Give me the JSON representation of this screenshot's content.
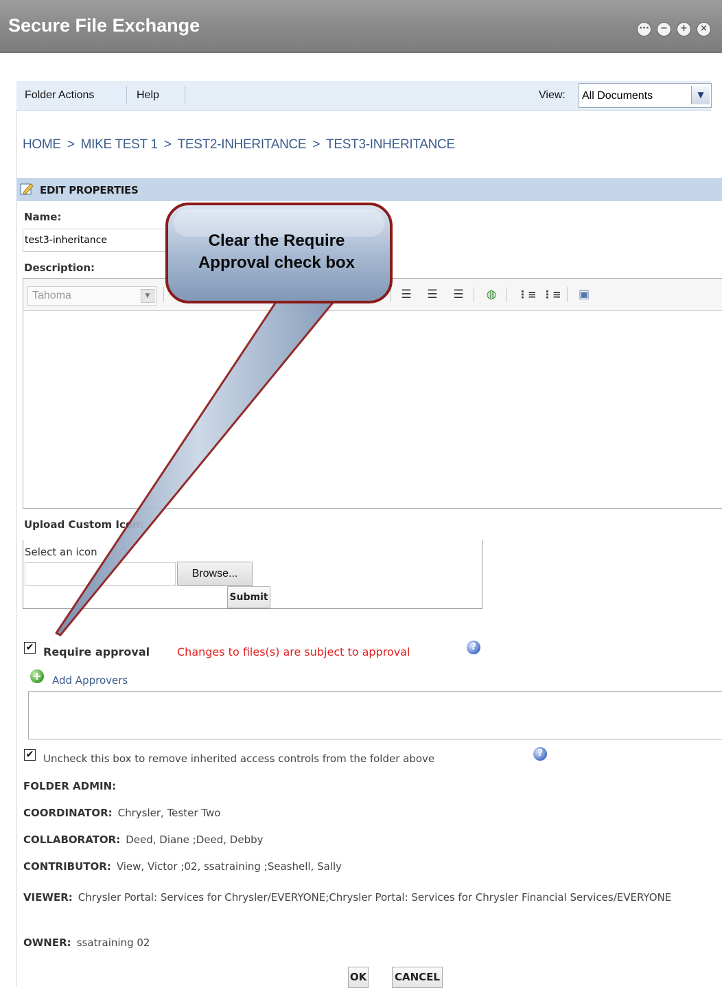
{
  "window": {
    "title": "Secure File Exchange",
    "buttons": [
      "···",
      "−",
      "+",
      "×"
    ]
  },
  "toolbar": {
    "folder_actions": "Folder Actions",
    "help": "Help",
    "view_label": "View:",
    "view_value": "All Documents"
  },
  "breadcrumb": {
    "items": [
      "HOME",
      "MIKE TEST 1",
      "TEST2-INHERITANCE",
      "TEST3-INHERITANCE"
    ],
    "separator": ">"
  },
  "section": {
    "title": "EDIT PROPERTIES"
  },
  "form": {
    "name_label": "Name:",
    "name_value": "test3-inheritance",
    "description_label": "Description:",
    "font_value": "Tahoma",
    "upload_label": "Upload Custom Icon:",
    "select_icon": "Select an icon",
    "browse": "Browse...",
    "submit": "Submit",
    "require_approval_label": "Require approval",
    "require_approval_checked": true,
    "approval_note": "Changes to files(s) are subject to approval",
    "add_approvers": "Add Approvers",
    "inherit_label": "Uncheck this box to remove inherited access controls from the folder above",
    "inherit_checked": true
  },
  "roles": {
    "folder_admin": {
      "label": "FOLDER ADMIN:",
      "value": ""
    },
    "coordinator": {
      "label": "COORDINATOR:",
      "value": "Chrysler, Tester Two"
    },
    "collaborator": {
      "label": "COLLABORATOR:",
      "value": "Deed, Diane ;Deed, Debby"
    },
    "contributor": {
      "label": "CONTRIBUTOR:",
      "value": "View, Victor ;02, ssatraining ;Seashell, Sally"
    },
    "viewer": {
      "label": "VIEWER:",
      "value": "Chrysler Portal: Services for Chrysler/EVERYONE;Chrysler Portal: Services for Chrysler Financial Services/EVERYONE"
    },
    "owner": {
      "label": "OWNER:",
      "value": "ssatraining 02"
    }
  },
  "actions": {
    "ok": "OK",
    "cancel": "CANCEL"
  },
  "callout": {
    "line1": "Clear the Require",
    "line2": "Approval check box"
  },
  "colors": {
    "accent_red": "#e02020",
    "link_blue": "#3a5c8c",
    "callout_border": "#8b1a1a"
  }
}
